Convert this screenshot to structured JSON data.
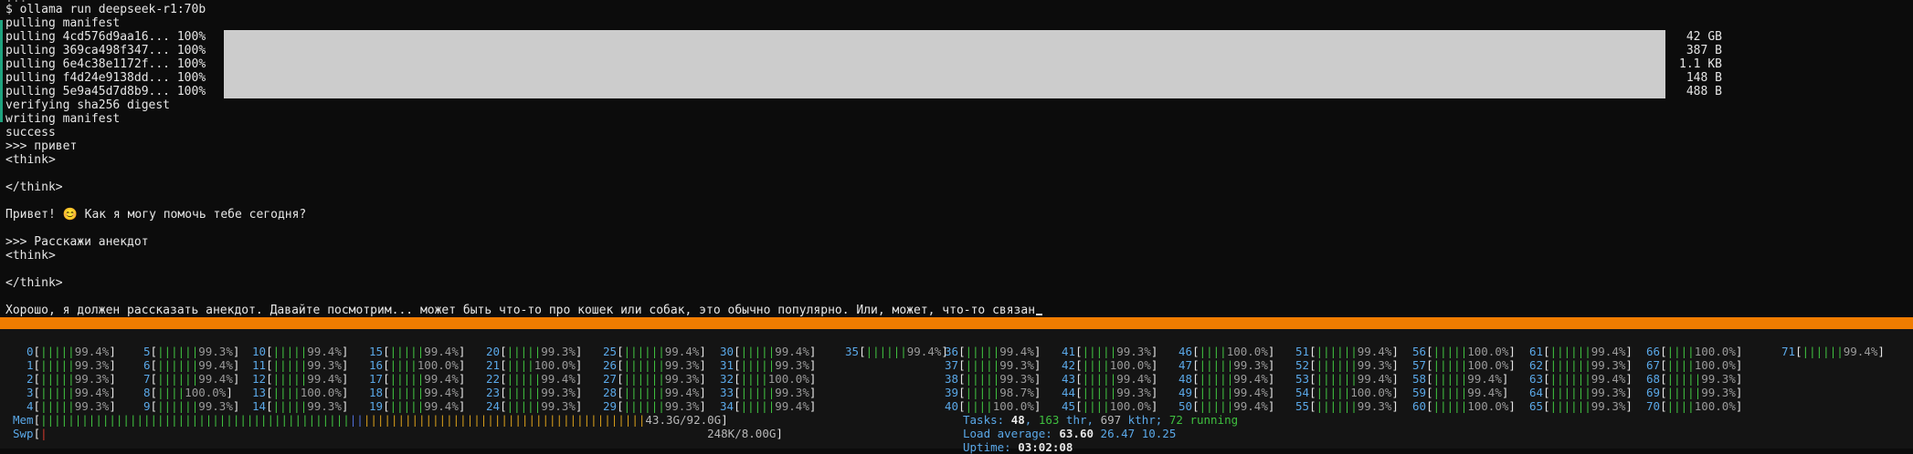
{
  "terminal": {
    "top_fragment": "...",
    "command": "$ ollama run deepseek-r1:70b",
    "pulling_manifest": "pulling manifest",
    "pulls": [
      {
        "label": "pulling 4cd576d9aa16... 100%",
        "size": "42 GB",
        "progress": 1.0
      },
      {
        "label": "pulling 369ca498f347... 100%",
        "size": "387 B",
        "progress": 1.0
      },
      {
        "label": "pulling 6e4c38e1172f... 100%",
        "size": "1.1 KB",
        "progress": 1.0
      },
      {
        "label": "pulling f4d24e9138dd... 100%",
        "size": "148 B",
        "progress": 1.0
      },
      {
        "label": "pulling 5e9a45d7d8b9... 100%",
        "size": "488 B",
        "progress": 1.0
      }
    ],
    "verifying": "verifying sha256 digest",
    "writing": "writing manifest",
    "success": "success",
    "prompt1": ">>> привет",
    "think_open_1": "<think>",
    "think_close_1": "</think>",
    "reply1": "Привет! 😊 Как я могу помочь тебе сегодня?",
    "prompt2": ">>> Расскажи анекдот",
    "think_open_2": "<think>",
    "think_close_2": "</think>",
    "reply2_partial": "Хорошо, я должен рассказать анекдот. Давайте посмотрим... может быть что-то про кошек или собак, это обычно популярно. Или, может, что-то связан"
  },
  "htop": {
    "cpus": [
      {
        "id": "0",
        "bars": "|||||",
        "pct": "99.4%"
      },
      {
        "id": "1",
        "bars": "|||||",
        "pct": "99.3%"
      },
      {
        "id": "2",
        "bars": "|||||",
        "pct": "99.3%"
      },
      {
        "id": "3",
        "bars": "|||||",
        "pct": "99.4%"
      },
      {
        "id": "4",
        "bars": "|||||",
        "pct": "99.3%"
      },
      {
        "id": "5",
        "bars": "||||||",
        "pct": "99.3%"
      },
      {
        "id": "6",
        "bars": "||||||",
        "pct": "99.4%"
      },
      {
        "id": "7",
        "bars": "||||||",
        "pct": "99.4%"
      },
      {
        "id": "8",
        "bars": "||||",
        "pct": "100.0%"
      },
      {
        "id": "9",
        "bars": "||||||",
        "pct": "99.3%"
      },
      {
        "id": "10",
        "bars": "|||||",
        "pct": "99.4%"
      },
      {
        "id": "11",
        "bars": "|||||",
        "pct": "99.3%"
      },
      {
        "id": "12",
        "bars": "|||||",
        "pct": "99.4%"
      },
      {
        "id": "13",
        "bars": "||||",
        "pct": "100.0%"
      },
      {
        "id": "14",
        "bars": "|||||",
        "pct": "99.3%"
      },
      {
        "id": "15",
        "bars": "|||||",
        "pct": "99.4%"
      },
      {
        "id": "16",
        "bars": "||||",
        "pct": "100.0%"
      },
      {
        "id": "17",
        "bars": "|||||",
        "pct": "99.4%"
      },
      {
        "id": "18",
        "bars": "|||||",
        "pct": "99.4%"
      },
      {
        "id": "19",
        "bars": "|||||",
        "pct": "99.4%"
      },
      {
        "id": "20",
        "bars": "|||||",
        "pct": "99.3%"
      },
      {
        "id": "21",
        "bars": "||||",
        "pct": "100.0%"
      },
      {
        "id": "22",
        "bars": "|||||",
        "pct": "99.4%"
      },
      {
        "id": "23",
        "bars": "|||||",
        "pct": "99.3%"
      },
      {
        "id": "24",
        "bars": "|||||",
        "pct": "99.3%"
      },
      {
        "id": "25",
        "bars": "||||||",
        "pct": "99.4%"
      },
      {
        "id": "26",
        "bars": "||||||",
        "pct": "99.3%"
      },
      {
        "id": "27",
        "bars": "||||||",
        "pct": "99.3%"
      },
      {
        "id": "28",
        "bars": "||||||",
        "pct": "99.4%"
      },
      {
        "id": "29",
        "bars": "||||||",
        "pct": "99.3%"
      },
      {
        "id": "30",
        "bars": "|||||",
        "pct": "99.4%"
      },
      {
        "id": "31",
        "bars": "|||||",
        "pct": "99.3%"
      },
      {
        "id": "32",
        "bars": "||||",
        "pct": "100.0%"
      },
      {
        "id": "33",
        "bars": "|||||",
        "pct": "99.3%"
      },
      {
        "id": "34",
        "bars": "|||||",
        "pct": "99.4%"
      },
      {
        "id": "35",
        "bars": "||||||",
        "pct": "99.4%"
      },
      {
        "id": "36",
        "bars": "|||||",
        "pct": "99.4%"
      },
      {
        "id": "37",
        "bars": "|||||",
        "pct": "99.3%"
      },
      {
        "id": "38",
        "bars": "|||||",
        "pct": "99.3%"
      },
      {
        "id": "39",
        "bars": "|||||",
        "pct": "98.7%"
      },
      {
        "id": "40",
        "bars": "||||",
        "pct": "100.0%"
      },
      {
        "id": "41",
        "bars": "|||||",
        "pct": "99.3%"
      },
      {
        "id": "42",
        "bars": "||||",
        "pct": "100.0%"
      },
      {
        "id": "43",
        "bars": "|||||",
        "pct": "99.4%"
      },
      {
        "id": "44",
        "bars": "|||||",
        "pct": "99.3%"
      },
      {
        "id": "45",
        "bars": "||||",
        "pct": "100.0%"
      },
      {
        "id": "46",
        "bars": "||||",
        "pct": "100.0%"
      },
      {
        "id": "47",
        "bars": "|||||",
        "pct": "99.3%"
      },
      {
        "id": "48",
        "bars": "|||||",
        "pct": "99.4%"
      },
      {
        "id": "49",
        "bars": "|||||",
        "pct": "99.4%"
      },
      {
        "id": "50",
        "bars": "|||||",
        "pct": "99.4%"
      },
      {
        "id": "51",
        "bars": "||||||",
        "pct": "99.4%"
      },
      {
        "id": "52",
        "bars": "||||||",
        "pct": "99.3%"
      },
      {
        "id": "53",
        "bars": "||||||",
        "pct": "99.4%"
      },
      {
        "id": "54",
        "bars": "|||||",
        "pct": "100.0%"
      },
      {
        "id": "55",
        "bars": "||||||",
        "pct": "99.3%"
      },
      {
        "id": "56",
        "bars": "|||||",
        "pct": "100.0%"
      },
      {
        "id": "57",
        "bars": "|||||",
        "pct": "100.0%"
      },
      {
        "id": "58",
        "bars": "|||||",
        "pct": "99.4%"
      },
      {
        "id": "59",
        "bars": "|||||",
        "pct": "99.4%"
      },
      {
        "id": "60",
        "bars": "|||||",
        "pct": "100.0%"
      },
      {
        "id": "61",
        "bars": "||||||",
        "pct": "99.4%"
      },
      {
        "id": "62",
        "bars": "||||||",
        "pct": "99.3%"
      },
      {
        "id": "63",
        "bars": "||||||",
        "pct": "99.4%"
      },
      {
        "id": "64",
        "bars": "||||||",
        "pct": "99.3%"
      },
      {
        "id": "65",
        "bars": "||||||",
        "pct": "99.3%"
      },
      {
        "id": "66",
        "bars": "||||",
        "pct": "100.0%"
      },
      {
        "id": "67",
        "bars": "||||",
        "pct": "100.0%"
      },
      {
        "id": "68",
        "bars": "|||||",
        "pct": "99.3%"
      },
      {
        "id": "69",
        "bars": "|||||",
        "pct": "99.3%"
      },
      {
        "id": "70",
        "bars": "||||",
        "pct": "100.0%"
      },
      {
        "id": "71",
        "bars": "||||||",
        "pct": "99.4%"
      }
    ],
    "mem": {
      "label": "Mem",
      "value": "43.3G/92.0G",
      "fraction": 0.47
    },
    "swp": {
      "label": "Swp",
      "value": "248K/8.00G"
    },
    "tasks": {
      "label": "Tasks:",
      "count": "48",
      "thr": "163",
      "thr_label": "thr,",
      "kthr": "697",
      "kthr_label": "kthr;",
      "running": "72",
      "running_label": "running"
    },
    "load": {
      "label": "Load average:",
      "v1": "63.60",
      "v5": "26.47",
      "v15": "10.25"
    },
    "uptime": {
      "label": "Uptime:",
      "value": "03:02:08"
    }
  },
  "colors": {
    "accent_orange": "#f07c00",
    "progress_fill": "#cccccc",
    "htop_green": "#3fbf3f",
    "htop_blue": "#5aa8e8"
  }
}
